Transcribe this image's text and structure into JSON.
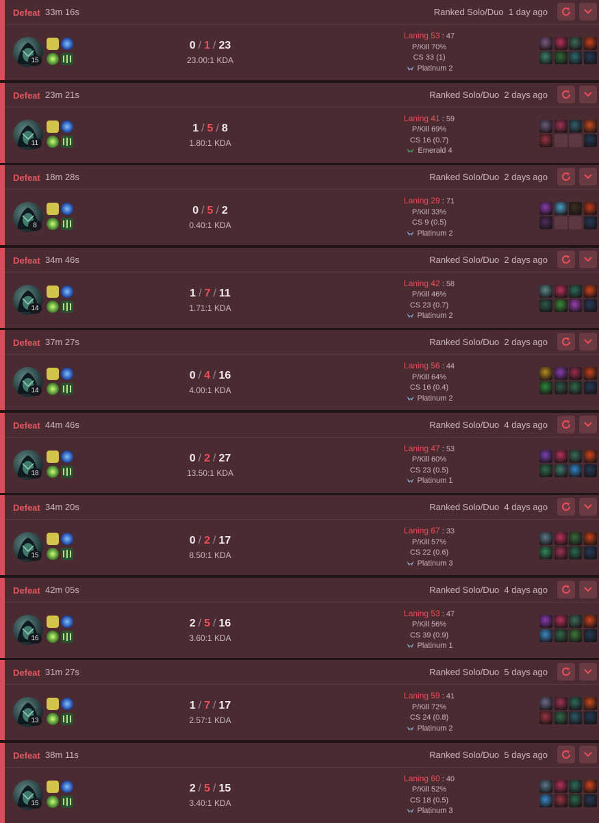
{
  "matches": [
    {
      "result": "Defeat",
      "duration": "33m 16s",
      "queue": "Ranked Solo/Duo",
      "ago": "1 day ago",
      "level": "15",
      "kills": "0",
      "deaths": "1",
      "assists": "23",
      "kda": "23.00:1 KDA",
      "laning_label": "Laning 53",
      "laning_opp": "47",
      "pkill": "P/Kill 70%",
      "cs": "CS 33 (1)",
      "avg_rank": "Platinum 2",
      "rank_color": "#8fb6e6",
      "empty_slots": 0
    },
    {
      "result": "Defeat",
      "duration": "23m 21s",
      "queue": "Ranked Solo/Duo",
      "ago": "2 days ago",
      "level": "11",
      "kills": "1",
      "deaths": "5",
      "assists": "8",
      "kda": "1.80:1 KDA",
      "laning_label": "Laning 41",
      "laning_opp": "59",
      "pkill": "P/Kill 69%",
      "cs": "CS 16 (0.7)",
      "avg_rank": "Emerald 4",
      "rank_color": "#3fb46a",
      "empty_slots": 2
    },
    {
      "result": "Defeat",
      "duration": "18m 28s",
      "queue": "Ranked Solo/Duo",
      "ago": "2 days ago",
      "level": "8",
      "kills": "0",
      "deaths": "5",
      "assists": "2",
      "kda": "0.40:1 KDA",
      "laning_label": "Laning 29",
      "laning_opp": "71",
      "pkill": "P/Kill 33%",
      "cs": "CS 9 (0.5)",
      "avg_rank": "Platinum 2",
      "rank_color": "#8fb6e6",
      "empty_slots": 2
    },
    {
      "result": "Defeat",
      "duration": "34m 46s",
      "queue": "Ranked Solo/Duo",
      "ago": "2 days ago",
      "level": "14",
      "kills": "1",
      "deaths": "7",
      "assists": "11",
      "kda": "1.71:1 KDA",
      "laning_label": "Laning 42",
      "laning_opp": "58",
      "pkill": "P/Kill 46%",
      "cs": "CS 23 (0.7)",
      "avg_rank": "Platinum 2",
      "rank_color": "#8fb6e6",
      "empty_slots": 0
    },
    {
      "result": "Defeat",
      "duration": "37m 27s",
      "queue": "Ranked Solo/Duo",
      "ago": "2 days ago",
      "level": "14",
      "kills": "0",
      "deaths": "4",
      "assists": "16",
      "kda": "4.00:1 KDA",
      "laning_label": "Laning 56",
      "laning_opp": "44",
      "pkill": "P/Kill 64%",
      "cs": "CS 16 (0.4)",
      "avg_rank": "Platinum 2",
      "rank_color": "#8fb6e6",
      "empty_slots": 0
    },
    {
      "result": "Defeat",
      "duration": "44m 46s",
      "queue": "Ranked Solo/Duo",
      "ago": "4 days ago",
      "level": "18",
      "kills": "0",
      "deaths": "2",
      "assists": "27",
      "kda": "13.50:1 KDA",
      "laning_label": "Laning 47",
      "laning_opp": "53",
      "pkill": "P/Kill 60%",
      "cs": "CS 23 (0.5)",
      "avg_rank": "Platinum 1",
      "rank_color": "#8fb6e6",
      "empty_slots": 0
    },
    {
      "result": "Defeat",
      "duration": "34m 20s",
      "queue": "Ranked Solo/Duo",
      "ago": "4 days ago",
      "level": "15",
      "kills": "0",
      "deaths": "2",
      "assists": "17",
      "kda": "8.50:1 KDA",
      "laning_label": "Laning 67",
      "laning_opp": "33",
      "pkill": "P/Kill 57%",
      "cs": "CS 22 (0.6)",
      "avg_rank": "Platinum 3",
      "rank_color": "#8fb6e6",
      "empty_slots": 0
    },
    {
      "result": "Defeat",
      "duration": "42m 05s",
      "queue": "Ranked Solo/Duo",
      "ago": "4 days ago",
      "level": "16",
      "kills": "2",
      "deaths": "5",
      "assists": "16",
      "kda": "3.60:1 KDA",
      "laning_label": "Laning 53",
      "laning_opp": "47",
      "pkill": "P/Kill 56%",
      "cs": "CS 39 (0.9)",
      "avg_rank": "Platinum 1",
      "rank_color": "#8fb6e6",
      "empty_slots": 0
    },
    {
      "result": "Defeat",
      "duration": "31m 27s",
      "queue": "Ranked Solo/Duo",
      "ago": "5 days ago",
      "level": "13",
      "kills": "1",
      "deaths": "7",
      "assists": "17",
      "kda": "2.57:1 KDA",
      "laning_label": "Laning 59",
      "laning_opp": "41",
      "pkill": "P/Kill 72%",
      "cs": "CS 24 (0.8)",
      "avg_rank": "Platinum 2",
      "rank_color": "#8fb6e6",
      "empty_slots": 0
    },
    {
      "result": "Defeat",
      "duration": "38m 11s",
      "queue": "Ranked Solo/Duo",
      "ago": "5 days ago",
      "level": "15",
      "kills": "2",
      "deaths": "5",
      "assists": "15",
      "kda": "3.40:1 KDA",
      "laning_label": "Laning 60",
      "laning_opp": "40",
      "pkill": "P/Kill 52%",
      "cs": "CS 18 (0.5)",
      "avg_rank": "Platinum 3",
      "rank_color": "#8fb6e6",
      "empty_slots": 0
    }
  ],
  "icons": {
    "replay_button": "replay-icon",
    "expand_button": "chevron-down-icon",
    "champion": "champion-portrait",
    "spells": [
      "flash-icon",
      "barrier-icon"
    ],
    "runes": [
      "keystone-rune-icon",
      "secondary-rune-icon"
    ]
  },
  "colors": {
    "defeat": "#e45560",
    "card_bg": "#4a2b32",
    "accent": "#ec4d57"
  }
}
